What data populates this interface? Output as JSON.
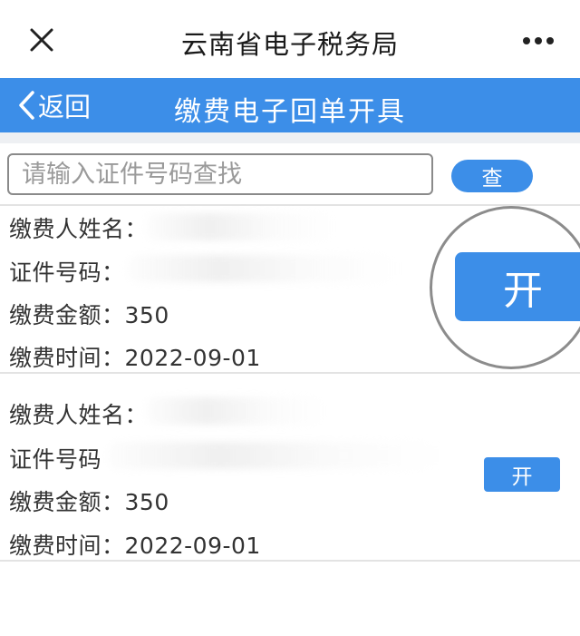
{
  "window": {
    "title": "云南省电子税务局"
  },
  "navbar": {
    "back_label": "返回",
    "title": "缴费电子回单开具"
  },
  "search": {
    "placeholder": "请输入证件号码查找",
    "value": "",
    "button_label": "查"
  },
  "records": [
    {
      "payer_name_label": "缴费人姓名：",
      "id_number_label": "证件号码：",
      "amount_label": "缴费金额：",
      "amount": "350",
      "time_label": "缴费时间：",
      "time": "2022-09-01",
      "open_button_label": "开"
    },
    {
      "payer_name_label": "缴费人姓名：",
      "id_number_label": "证件号码",
      "amount_label": "缴费金额：",
      "amount": "350",
      "time_label": "缴费时间：",
      "time": "2022-09-01",
      "open_button_label": "开"
    }
  ],
  "colors": {
    "accent": "#3c8ee8",
    "page_gap": "#eef0f3",
    "highlight_ring": "#8c8c8c"
  },
  "icons": {
    "close": "close-icon",
    "more": "more-icon",
    "back": "chevron-left-icon"
  }
}
